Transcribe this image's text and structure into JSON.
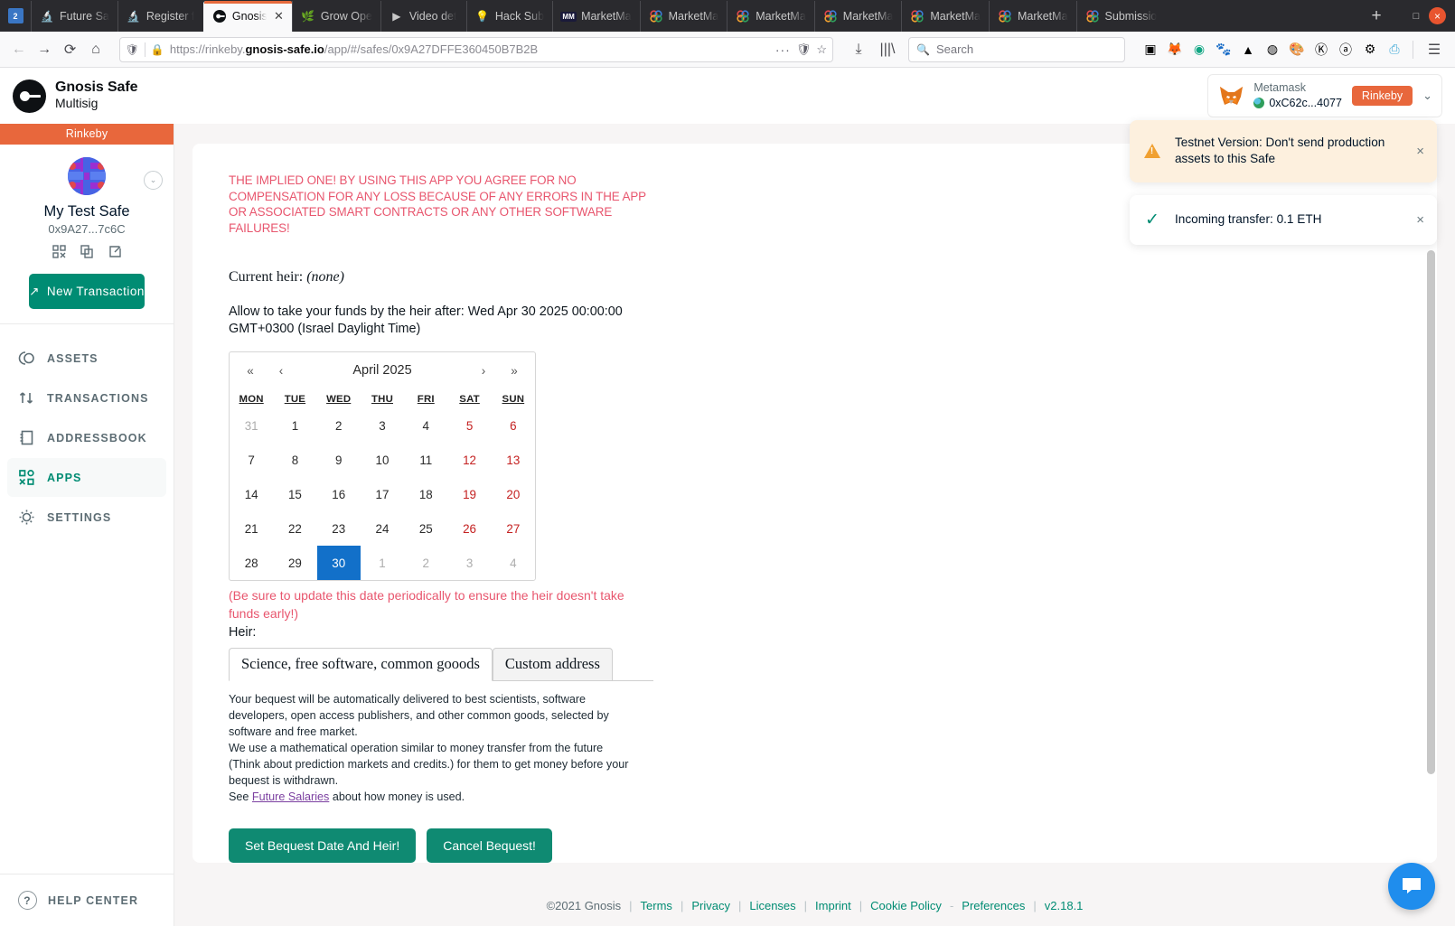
{
  "browser": {
    "app_icon": "app-icon",
    "tabs": [
      {
        "label": "Future Sa",
        "favicon": "🔬",
        "active": false
      },
      {
        "label": "Register f",
        "favicon": "🔬",
        "active": false
      },
      {
        "label": "Gnosis",
        "favicon": "gnosis-icon",
        "active": true
      },
      {
        "label": "Grow Ope",
        "favicon": "🌿",
        "active": false
      },
      {
        "label": "Video det",
        "favicon": "▶",
        "active": false
      },
      {
        "label": "Hack Sub",
        "favicon": "💡",
        "active": false
      },
      {
        "label": "MarketMa",
        "favicon": "MM",
        "active": false
      },
      {
        "label": "MarketMa",
        "favicon": "MM",
        "active": false
      },
      {
        "label": "MarketMa",
        "favicon": "MM",
        "active": false
      },
      {
        "label": "MarketMa",
        "favicon": "MM",
        "active": false
      },
      {
        "label": "MarketMa",
        "favicon": "MM",
        "active": false
      },
      {
        "label": "MarketMa",
        "favicon": "MM",
        "active": false
      },
      {
        "label": "Submissio",
        "favicon": "MM",
        "active": false
      }
    ],
    "new_tab_label": "+",
    "window_buttons": {
      "minimize": "—",
      "maximize": "□",
      "close": "×"
    },
    "nav": {
      "back": "←",
      "forward": "→",
      "reload": "⟳",
      "home": "⌂"
    },
    "url": {
      "scheme": "https://rinkeby.",
      "domain": "gnosis-safe.io",
      "path": "/app/#/safes/0x9A27DFFE360450B7B2B",
      "shield_icon": "shield-icon",
      "lock_icon": "lock-icon",
      "more_icon": "···",
      "pocket_icon": "pocket-icon",
      "bookmark_icon": "☆"
    },
    "downloads_icon": "download-icon",
    "library_icon": "library-icon",
    "search": {
      "placeholder": "Search",
      "icon": "search-icon"
    },
    "extensions": [
      "sidebar-icon",
      "metamask-icon",
      "grammarly-icon",
      "gnome-icon",
      "drive-icon",
      "account-icon",
      "palette-icon",
      "kiwi-icon",
      "archive-icon",
      "gear-icon",
      "clipboard-icon"
    ],
    "menu_icon": "☰"
  },
  "app": {
    "logo": {
      "line1": "Gnosis Safe",
      "line2": "Multisig"
    },
    "wallet": {
      "provider": "Metamask",
      "address": "0xC62c...4077",
      "network_badge": "Rinkeby",
      "chevron": "⌄"
    }
  },
  "sidebar": {
    "network": "Rinkeby",
    "safe_name": "My Test Safe",
    "safe_address": "0x9A27...7c6C",
    "actions": [
      "qr-code-icon",
      "copy-icon",
      "external-link-icon"
    ],
    "new_transaction": "New Transaction",
    "items": [
      {
        "label": "ASSETS",
        "icon": "assets-icon",
        "active": false
      },
      {
        "label": "TRANSACTIONS",
        "icon": "transactions-icon",
        "active": false
      },
      {
        "label": "ADDRESSBOOK",
        "icon": "addressbook-icon",
        "active": false
      },
      {
        "label": "APPS",
        "icon": "apps-icon",
        "active": true
      },
      {
        "label": "SETTINGS",
        "icon": "settings-icon",
        "active": false
      }
    ],
    "help_center": "HELP CENTER"
  },
  "main": {
    "disclaimer": "THE IMPLIED ONE! BY USING THIS APP YOU AGREE FOR NO COMPENSATION FOR ANY LOSS BECAUSE OF ANY ERRORS IN THE APP OR ASSOCIATED SMART CONTRACTS OR ANY OTHER SOFTWARE FAILURES!",
    "current_heir_label": "Current heir:",
    "current_heir_value": "(none)",
    "allow_line": "Allow to take your funds by the heir after: Wed Apr 30 2025 00:00:00 GMT+0300 (Israel Daylight Time)",
    "calendar": {
      "title": "April 2025",
      "nav": {
        "prev_year": "«",
        "prev_month": "‹",
        "next_month": "›",
        "next_year": "»"
      },
      "day_names": [
        "MON",
        "TUE",
        "WED",
        "THU",
        "FRI",
        "SAT",
        "SUN"
      ],
      "selected_day": 30,
      "weeks": [
        [
          {
            "d": "31",
            "t": "mut"
          },
          {
            "d": "1",
            "t": "cur"
          },
          {
            "d": "2",
            "t": "cur"
          },
          {
            "d": "3",
            "t": "cur"
          },
          {
            "d": "4",
            "t": "cur"
          },
          {
            "d": "5",
            "t": "wk"
          },
          {
            "d": "6",
            "t": "wk"
          }
        ],
        [
          {
            "d": "7",
            "t": "cur"
          },
          {
            "d": "8",
            "t": "cur"
          },
          {
            "d": "9",
            "t": "cur"
          },
          {
            "d": "10",
            "t": "cur"
          },
          {
            "d": "11",
            "t": "cur"
          },
          {
            "d": "12",
            "t": "wk"
          },
          {
            "d": "13",
            "t": "wk"
          }
        ],
        [
          {
            "d": "14",
            "t": "cur"
          },
          {
            "d": "15",
            "t": "cur"
          },
          {
            "d": "16",
            "t": "cur"
          },
          {
            "d": "17",
            "t": "cur"
          },
          {
            "d": "18",
            "t": "cur"
          },
          {
            "d": "19",
            "t": "wk"
          },
          {
            "d": "20",
            "t": "wk"
          }
        ],
        [
          {
            "d": "21",
            "t": "cur"
          },
          {
            "d": "22",
            "t": "cur"
          },
          {
            "d": "23",
            "t": "cur"
          },
          {
            "d": "24",
            "t": "cur"
          },
          {
            "d": "25",
            "t": "cur"
          },
          {
            "d": "26",
            "t": "wk"
          },
          {
            "d": "27",
            "t": "wk"
          }
        ],
        [
          {
            "d": "28",
            "t": "cur"
          },
          {
            "d": "29",
            "t": "cur"
          },
          {
            "d": "30",
            "t": "sel"
          },
          {
            "d": "1",
            "t": "mut"
          },
          {
            "d": "2",
            "t": "mut"
          },
          {
            "d": "3",
            "t": "mut"
          },
          {
            "d": "4",
            "t": "mut"
          }
        ]
      ]
    },
    "calendar_warning": "(Be sure to update this date periodically to ensure the heir doesn't take funds early!)",
    "heir_label": "Heir:",
    "heir_tabs": [
      {
        "label": "Science, free software, common gooods",
        "active": true
      },
      {
        "label": "Custom address",
        "active": false
      }
    ],
    "paragraph1": "Your bequest will be automatically delivered to best scientists, software developers, open access publishers, and other common goods, selected by software and free market.",
    "paragraph2": "We use a mathematical operation similar to money transfer from the future (Think about prediction markets and credits.) for them to get money before your bequest is withdrawn.",
    "paragraph3_pre": "See ",
    "paragraph3_link": "Future Salaries",
    "paragraph3_post": " about how money is used.",
    "buttons": [
      {
        "label": "Set Bequest Date And Heir!"
      },
      {
        "label": "Cancel Bequest!"
      }
    ]
  },
  "toasts": [
    {
      "type": "warning",
      "icon": "warning-triangle-icon",
      "text": "Testnet Version: Don't send production assets to this Safe",
      "close": "×"
    },
    {
      "type": "success",
      "icon": "check-icon",
      "text": "Incoming transfer: 0.1 ETH",
      "close": "×"
    }
  ],
  "footer": {
    "copyright": "©2021 Gnosis",
    "links": [
      "Terms",
      "Privacy",
      "Licenses",
      "Imprint",
      "Cookie Policy",
      "Preferences"
    ],
    "version": "v2.18.1",
    "separator": "|",
    "dash": "-"
  },
  "intercom": {
    "icon": "chat-icon"
  },
  "colors": {
    "accent_green": "#008c73",
    "network_orange": "#e8673c",
    "warning_red": "#e8566e",
    "selected_blue": "#1270c9",
    "weekend_red": "#c42121"
  }
}
